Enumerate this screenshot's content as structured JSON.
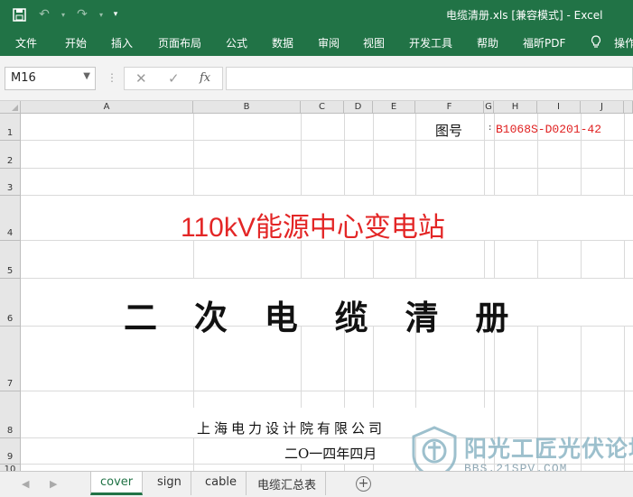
{
  "window": {
    "title": "电缆清册.xls  [兼容模式]  -  Excel"
  },
  "ribbon": {
    "tabs": [
      "文件",
      "开始",
      "插入",
      "页面布局",
      "公式",
      "数据",
      "审阅",
      "视图",
      "开发工具",
      "帮助",
      "福昕PDF",
      "操作"
    ]
  },
  "formula_bar": {
    "name_box": "M16",
    "cancel_icon": "✕",
    "enter_icon": "✓",
    "function_label": "fx",
    "formula_value": ""
  },
  "columns": [
    "A",
    "B",
    "C",
    "D",
    "E",
    "F",
    "G",
    "H",
    "I",
    "J"
  ],
  "rows": [
    "1",
    "2",
    "3",
    "4",
    "5",
    "6",
    "7",
    "8",
    "9",
    "10"
  ],
  "cells": {
    "drawing_no_label": "图号",
    "drawing_no_value": "B1068S-D0201-42",
    "project_title": "110kV能源中心变电站",
    "doc_title": "二 次 电  缆  清  册",
    "company": "上海电力设计院有限公司",
    "date": "二O一四年四月"
  },
  "sheets": {
    "tabs": [
      "cover",
      "sign",
      "cable",
      "电缆汇总表"
    ],
    "active": "cover"
  },
  "watermark": {
    "text": "阳光工匠光伏论坛",
    "url": "BBS.21SPV.COM"
  },
  "colors": {
    "excel_green": "#217346",
    "title_red": "#e32626"
  },
  "icons": {
    "save": "save-icon",
    "undo": "undo-icon",
    "redo": "redo-icon",
    "lightbulb": "lightbulb-icon"
  }
}
